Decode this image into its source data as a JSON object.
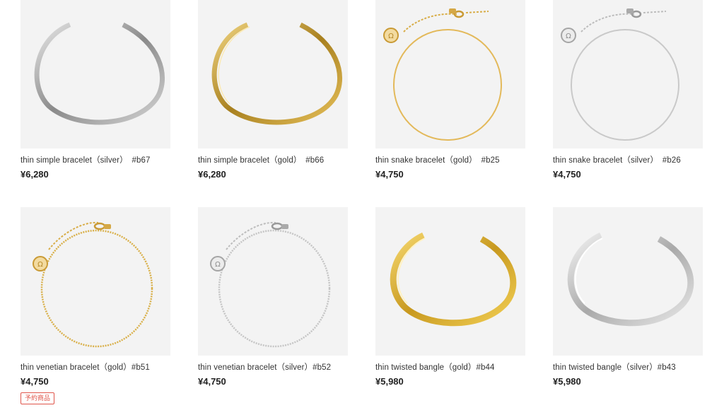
{
  "products": [
    {
      "name": "thin simple bracelet（silver）　#b67",
      "price": "¥6,280",
      "image": "silver-open-cuff-bracelet"
    },
    {
      "name": "thin simple bracelet（gold）　#b66",
      "price": "¥6,280",
      "image": "gold-open-cuff-bracelet"
    },
    {
      "name": "thin snake bracelet（gold）　#b25",
      "price": "¥4,750",
      "image": "gold-snake-chain-bracelet"
    },
    {
      "name": "thin snake bracelet（silver）　#b26",
      "price": "¥4,750",
      "image": "silver-snake-chain-bracelet"
    },
    {
      "name": "thin venetian bracelet（gold）#b51",
      "price": "¥4,750",
      "image": "gold-venetian-chain-bracelet",
      "badge": "予約商品"
    },
    {
      "name": "thin venetian bracelet（silver）#b52",
      "price": "¥4,750",
      "image": "silver-venetian-chain-bracelet"
    },
    {
      "name": "thin twisted bangle（gold）#b44",
      "price": "¥5,980",
      "image": "gold-twisted-bangle"
    },
    {
      "name": "thin twisted bangle（silver）#b43",
      "price": "¥5,980",
      "image": "silver-twisted-bangle"
    }
  ],
  "colors": {
    "silver": "#b9b9b9",
    "gold": "#d9b04a",
    "thumb_bg": "#f3f3f3",
    "badge": "#e0554a"
  }
}
